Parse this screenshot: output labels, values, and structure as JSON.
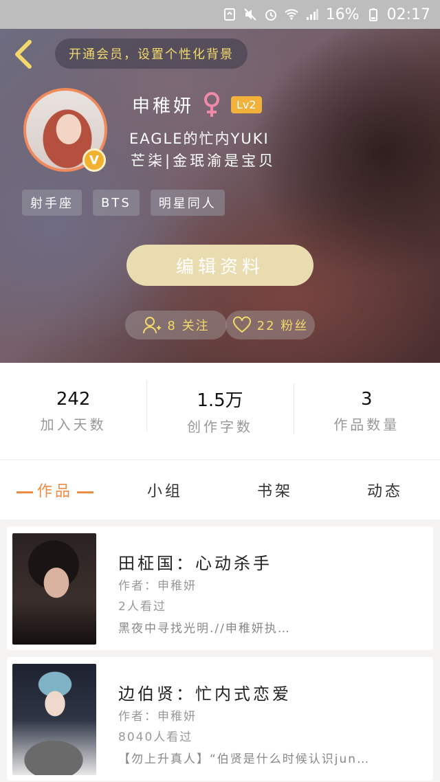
{
  "status_bar": {
    "battery": "16%",
    "time": "02:17",
    "network": "4G"
  },
  "header": {
    "member_banner": "开通会员，设置个性化背景",
    "user": {
      "name": "申稚妍",
      "gender_icon": "female-icon",
      "level": "Lv2",
      "vip_badge": "V",
      "bio_line1": "EAGLE的忙内YUKI",
      "bio_line2": "芒柒|金珉渝是宝贝"
    },
    "tags": [
      "射手座",
      "BTS",
      "明星同人"
    ],
    "edit_button": "编辑资料",
    "following_label": "8 关注",
    "fans_label": "22 粉丝"
  },
  "stats": [
    {
      "value": "242",
      "label": "加入天数"
    },
    {
      "value": "1.5万",
      "label": "创作字数"
    },
    {
      "value": "3",
      "label": "作品数量"
    }
  ],
  "tabs": [
    {
      "label": "作品",
      "active": true
    },
    {
      "label": "小组",
      "active": false
    },
    {
      "label": "书架",
      "active": false
    },
    {
      "label": "动态",
      "active": false
    }
  ],
  "works": [
    {
      "title": "田柾国：心动杀手",
      "author": "作者：申稚妍",
      "views": "2人看过",
      "desc": "黑夜中寻找光明.//申稚妍执…"
    },
    {
      "title": "边伯贤：忙内式恋爱",
      "author": "作者：申稚妍",
      "views": "8040人看过",
      "desc": "【勿上升真人】“伯贤是什么时候认识jun…"
    }
  ],
  "colors": {
    "accent": "#ee8b45",
    "gold_text": "#f3d96b",
    "edit_button": "#e8dcb0",
    "level_badge": "#f2b13b"
  }
}
